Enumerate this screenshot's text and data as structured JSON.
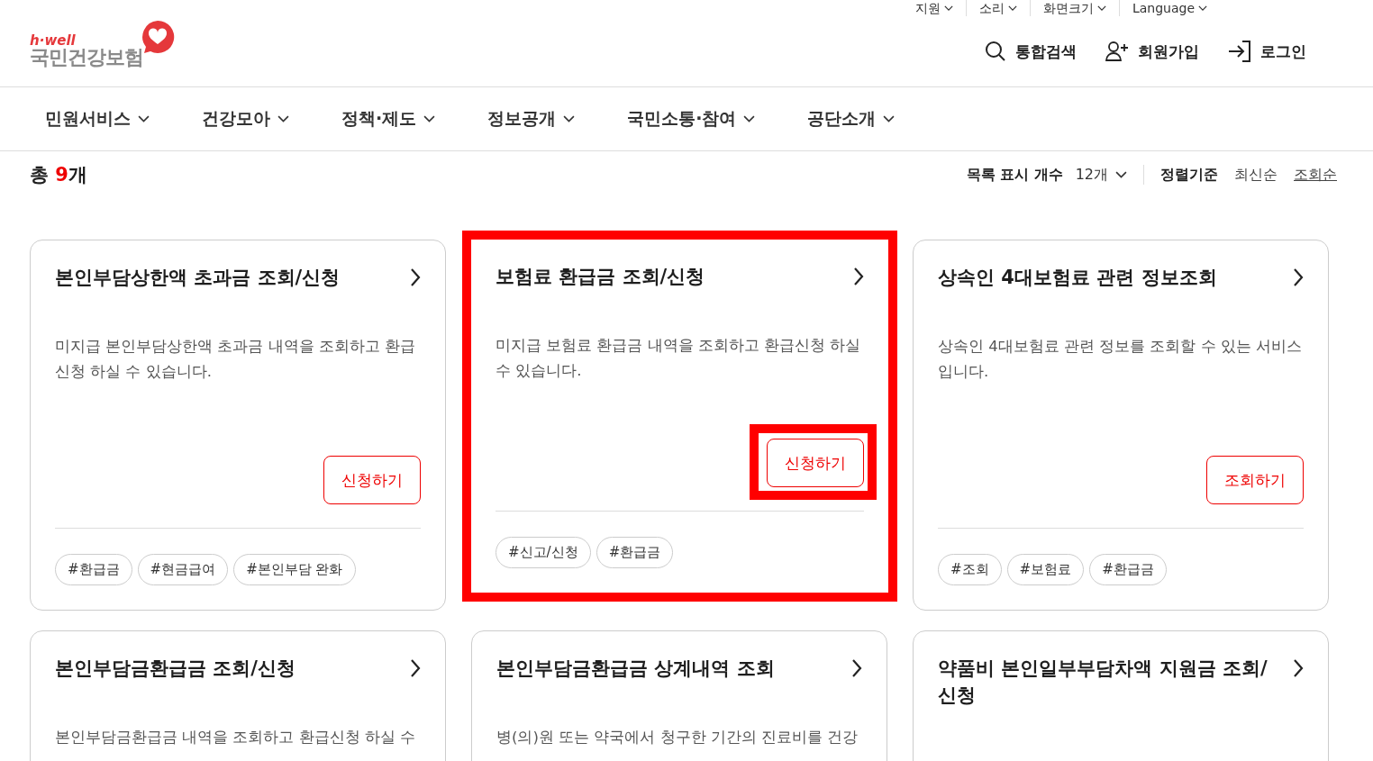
{
  "utility_menu": [
    {
      "label": "지원"
    },
    {
      "label": "소리"
    },
    {
      "label": "화면크기"
    },
    {
      "label": "Language"
    }
  ],
  "logo": {
    "tagline": "h·well",
    "name": "국민건강보험"
  },
  "header_actions": [
    {
      "kind": "search",
      "label": "통합검색"
    },
    {
      "kind": "join",
      "label": "회원가입"
    },
    {
      "kind": "login",
      "label": "로그인"
    }
  ],
  "nav": [
    {
      "label": "민원서비스"
    },
    {
      "label": "건강모아"
    },
    {
      "label": "정책·제도"
    },
    {
      "label": "정보공개"
    },
    {
      "label": "국민소통·참여"
    },
    {
      "label": "공단소개"
    }
  ],
  "summary": {
    "prefix": "총 ",
    "count": "9",
    "suffix": "개"
  },
  "list_options": {
    "count_label": "목록 표시 개수",
    "count_value": "12개",
    "sort_label": "정렬기준",
    "sorts": [
      {
        "label": "최신순",
        "selected": false
      },
      {
        "label": "조회순",
        "selected": true
      }
    ]
  },
  "cards": [
    {
      "title": "본인부담상한액 초과금 조회/신청",
      "description": "미지급 본인부담상한액 초과금 내역을 조회하고 환급 신청 하실 수 있습니다.",
      "button": "신청하기",
      "highlighted": false,
      "button_highlighted": false,
      "tags": [
        "#환급금",
        "#현금급여",
        "#본인부담 완화"
      ]
    },
    {
      "title": "보험료 환급금 조회/신청",
      "description": "미지급 보험료 환급금 내역을 조회하고 환급신청 하실 수 있습니다.",
      "button": "신청하기",
      "highlighted": true,
      "button_highlighted": true,
      "tags": [
        "#신고/신청",
        "#환급금"
      ]
    },
    {
      "title": "상속인 4대보험료 관련 정보조회",
      "description": "상속인 4대보험료 관련 정보를 조회할 수 있는 서비스입니다.",
      "button": "조회하기",
      "highlighted": false,
      "button_highlighted": false,
      "tags": [
        "#조회",
        "#보험료",
        "#환급금"
      ]
    },
    {
      "title": "본인부담금환급금 조회/신청",
      "description": "본인부담금환급금 내역을 조회하고 환급신청 하실 수",
      "highlighted": false
    },
    {
      "title": "본인부담금환급금 상계내역 조회",
      "description": "병(의)원 또는 약국에서 청구한 기간의 진료비를 건강",
      "highlighted": false
    },
    {
      "title": "약품비 본인일부부담차액 지원금 조회/신청",
      "highlighted": false
    }
  ]
}
